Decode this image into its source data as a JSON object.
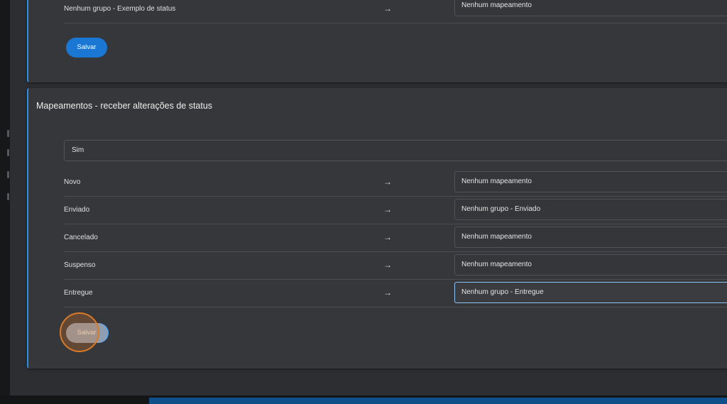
{
  "status_card": {
    "row": {
      "label": "Nenhum grupo - Exemplo de status",
      "arrow": "→",
      "value": "Nenhum mapeamento"
    },
    "save_label": "Salvar"
  },
  "receive_card": {
    "title": "Mapeamentos - receber alterações de status",
    "select_value": "Sim",
    "rows": [
      {
        "label": "Novo",
        "arrow": "→",
        "value": "Nenhum mapeamento"
      },
      {
        "label": "Enviado",
        "arrow": "→",
        "value": "Nenhum grupo - Enviado"
      },
      {
        "label": "Cancelado",
        "arrow": "→",
        "value": "Nenhum mapeamento"
      },
      {
        "label": "Suspenso",
        "arrow": "→",
        "value": "Nenhum mapeamento"
      },
      {
        "label": "Entregue",
        "arrow": "→",
        "value": "Nenhum grupo - Entregue"
      }
    ],
    "save_label": "Salvar"
  },
  "colors": {
    "accent": "#2f8fe6",
    "button": "#1a78d4",
    "click_highlight": "#d97a28"
  }
}
